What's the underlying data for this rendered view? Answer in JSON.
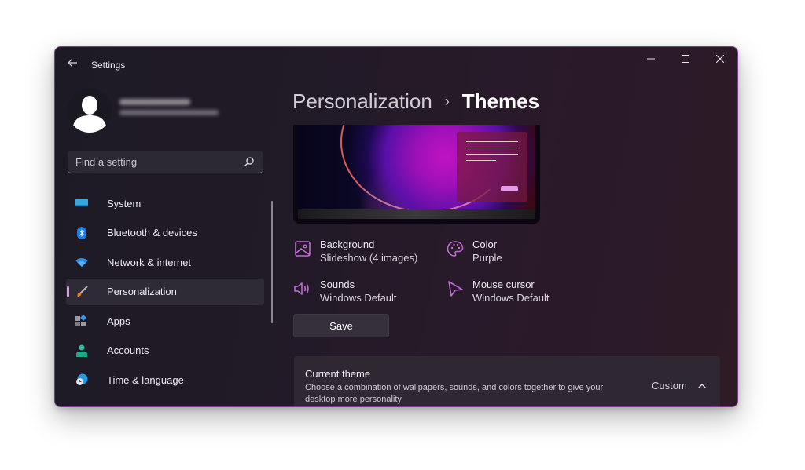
{
  "window": {
    "title": "Settings",
    "controls": {
      "minimize": "minimize",
      "maximize": "maximize",
      "close": "close"
    }
  },
  "profile": {
    "name": "(blurred)",
    "email": "(blurred)"
  },
  "search": {
    "placeholder": "Find a setting",
    "value": ""
  },
  "sidebar": {
    "items": [
      {
        "label": "System",
        "icon": "monitor-icon",
        "active": false
      },
      {
        "label": "Bluetooth & devices",
        "icon": "bluetooth-icon",
        "active": false
      },
      {
        "label": "Network & internet",
        "icon": "wifi-icon",
        "active": false
      },
      {
        "label": "Personalization",
        "icon": "paintbrush-icon",
        "active": true
      },
      {
        "label": "Apps",
        "icon": "apps-icon",
        "active": false
      },
      {
        "label": "Accounts",
        "icon": "person-icon",
        "active": false
      },
      {
        "label": "Time & language",
        "icon": "clock-globe-icon",
        "active": false
      }
    ]
  },
  "breadcrumb": {
    "parent": "Personalization",
    "separator": "›",
    "current": "Themes"
  },
  "theme_properties": [
    {
      "title": "Background",
      "value": "Slideshow (4 images)",
      "icon": "image-icon"
    },
    {
      "title": "Color",
      "value": "Purple",
      "icon": "palette-icon"
    },
    {
      "title": "Sounds",
      "value": "Windows Default",
      "icon": "speaker-icon"
    },
    {
      "title": "Mouse cursor",
      "value": "Windows Default",
      "icon": "cursor-icon"
    }
  ],
  "save_label": "Save",
  "current_theme": {
    "title": "Current theme",
    "description": "Choose a combination of wallpapers, sounds, and colors together to give your desktop more personality",
    "value": "Custom",
    "expanded": true
  },
  "colors": {
    "accent": "#c06ad4",
    "indicator": "#d39ae0",
    "window_border": "#7a3d8a"
  }
}
